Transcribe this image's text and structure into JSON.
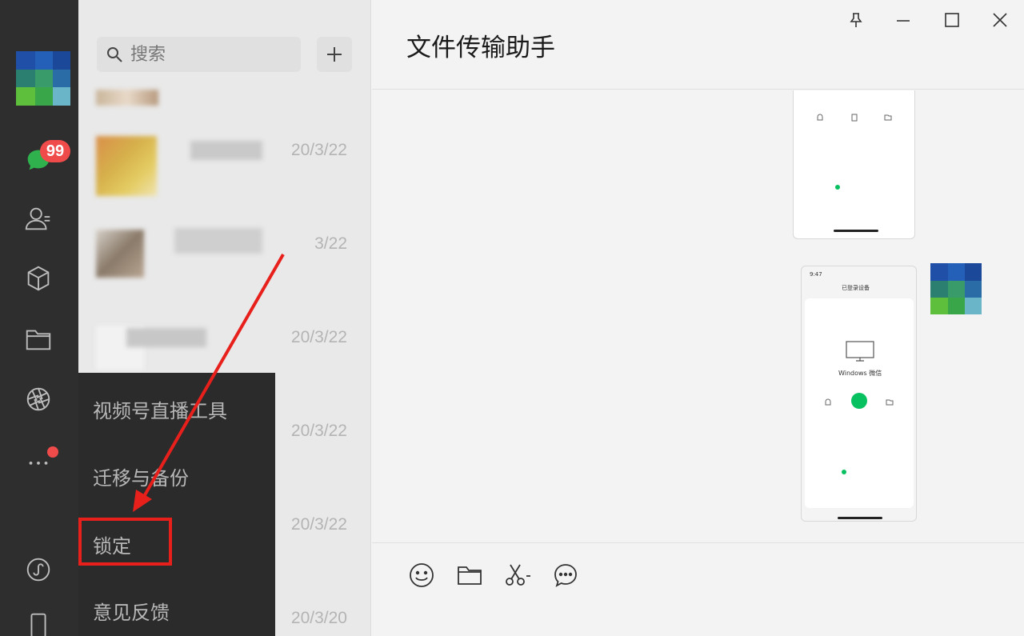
{
  "sidebar": {
    "badge_count": "99",
    "icons": [
      "chat-icon",
      "contacts-icon",
      "favorites-icon",
      "files-icon",
      "moments-icon",
      "more-icon",
      "miniprogram-icon",
      "phone-icon"
    ]
  },
  "search": {
    "placeholder": "搜索",
    "add_label": "+"
  },
  "chats": [
    {
      "date": "20/3/22"
    },
    {
      "date": "3/22"
    },
    {
      "date": "20/3/22"
    },
    {
      "date": "20/3/22"
    },
    {
      "date": "20/3/22"
    },
    {
      "date": "20/3/20"
    }
  ],
  "menu": {
    "items": [
      "视频号直播工具",
      "迁移与备份",
      "锁定",
      "意见反馈"
    ]
  },
  "main": {
    "title": "文件传输助手",
    "phone2": {
      "time": "9:47",
      "header": "已登录设备",
      "device_label": "Windows 微信"
    }
  },
  "colors": {
    "sidebar_bg": "#2e2e2e",
    "badge": "#f04b4b",
    "highlight": "#e8201c",
    "wechat_green": "#07c160"
  }
}
